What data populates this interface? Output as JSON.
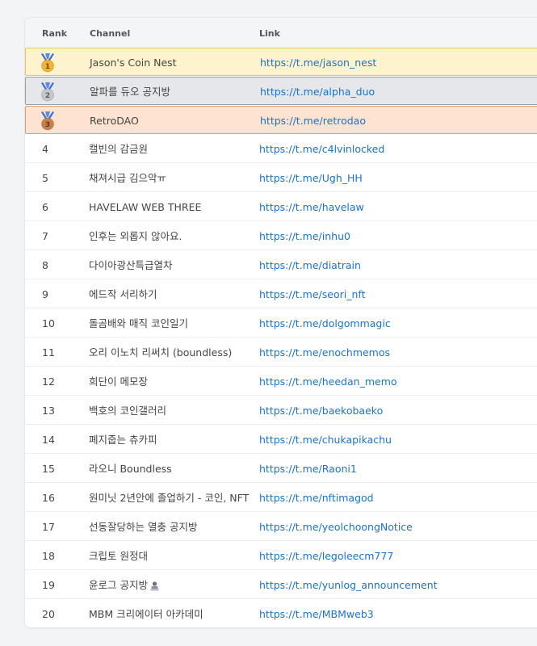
{
  "header": {
    "rank": "Rank",
    "channel": "Channel",
    "link": "Link"
  },
  "colors": {
    "gold": "#f2b233",
    "silver": "#c4c7cc",
    "bronze": "#c9804a",
    "link": "#1a73c9"
  },
  "rows": [
    {
      "rank": "1",
      "medal": "gold-medal-icon",
      "channel": "Jason's Coin Nest",
      "link": "https://t.me/jason_nest"
    },
    {
      "rank": "2",
      "medal": "silver-medal-icon",
      "channel": "알파를 듀오 공지방",
      "link": "https://t.me/alpha_duo"
    },
    {
      "rank": "3",
      "medal": "bronze-medal-icon",
      "channel": "RetroDAO",
      "link": "https://t.me/retrodao"
    },
    {
      "rank": "4",
      "channel": "캘빈의 감금원",
      "link": "https://t.me/c4lvinlocked"
    },
    {
      "rank": "5",
      "channel": "채져시급 김으악ㅠ",
      "link": "https://t.me/Ugh_HH"
    },
    {
      "rank": "6",
      "channel": "HAVELAW WEB THREE",
      "link": "https://t.me/havelaw"
    },
    {
      "rank": "7",
      "channel": "인후는 외롭지 않아요.",
      "link": "https://t.me/inhu0"
    },
    {
      "rank": "8",
      "channel": "다이아광산특급열차",
      "link": "https://t.me/diatrain"
    },
    {
      "rank": "9",
      "channel": "에드작 서리하기",
      "link": "https://t.me/seori_nft"
    },
    {
      "rank": "10",
      "channel": "돌곰배와 매직 코인일기",
      "link": "https://t.me/dolgommagic"
    },
    {
      "rank": "11",
      "channel": "오리 이노치 리써치 (boundless)",
      "link": "https://t.me/enochmemos"
    },
    {
      "rank": "12",
      "channel": "희단이 메모장",
      "link": "https://t.me/heedan_memo"
    },
    {
      "rank": "13",
      "channel": "백호의 코인갤러리",
      "link": "https://t.me/baekobaeko"
    },
    {
      "rank": "14",
      "channel": "폐지줍는 츄카피",
      "link": "https://t.me/chukapikachu"
    },
    {
      "rank": "15",
      "channel": "라오니 Boundless",
      "link": "https://t.me/Raoni1"
    },
    {
      "rank": "16",
      "channel": "원미닛 2년안에 졸업하기 - 코인, NFT",
      "link": "https://t.me/nftimagod"
    },
    {
      "rank": "17",
      "channel": "선동잘당하는 열충 공지방",
      "link": "https://t.me/yeolchoongNotice"
    },
    {
      "rank": "18",
      "channel": "크립토 원정대",
      "link": "https://t.me/legoleecm777"
    },
    {
      "rank": "19",
      "channel": "윤로그 공지방",
      "emoji": "person-laptop-icon",
      "link": "https://t.me/yunlog_announcement"
    },
    {
      "rank": "20",
      "channel": "MBM 크리에이터 아카데미",
      "link": "https://t.me/MBMweb3"
    }
  ]
}
